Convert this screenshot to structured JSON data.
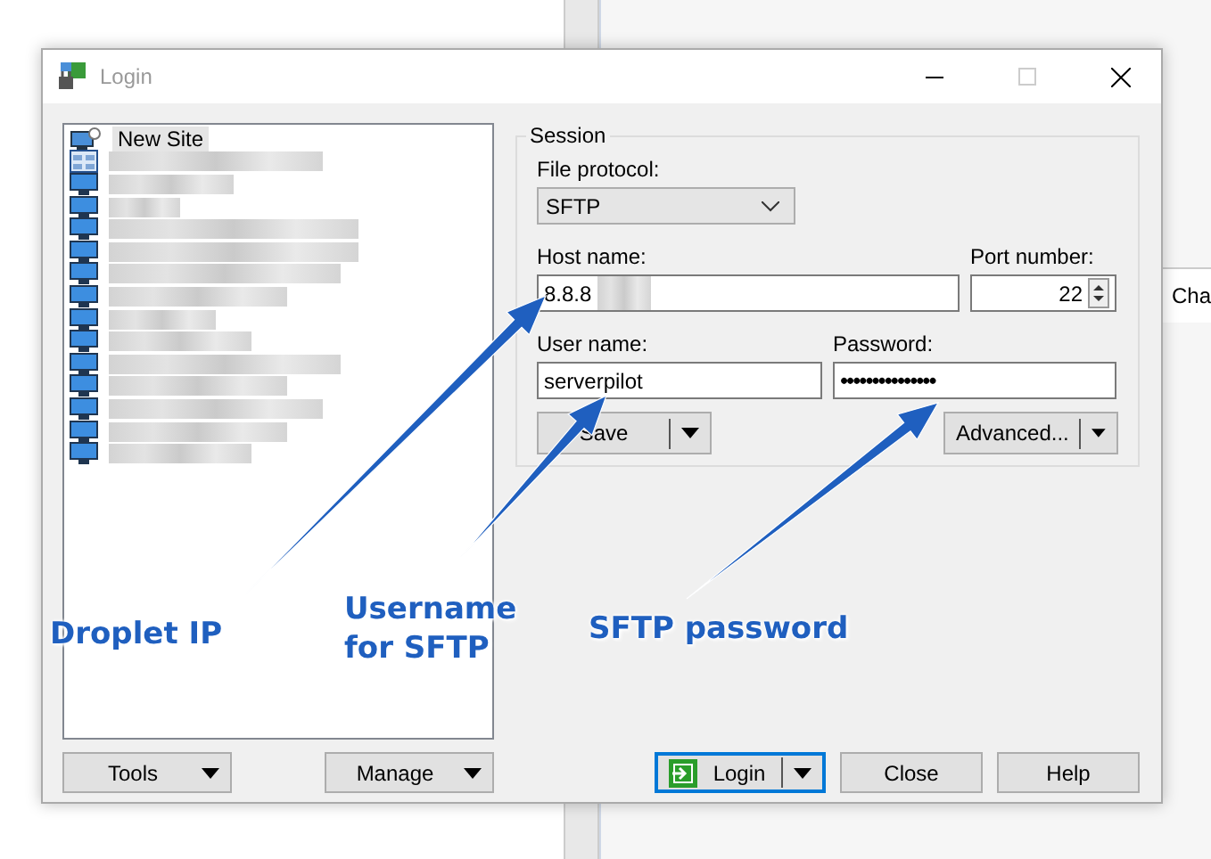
{
  "window": {
    "title": "Login"
  },
  "sites": [
    {
      "kind": "new-site",
      "label": "New Site",
      "selected": true
    },
    {
      "kind": "workspace",
      "selected": false
    },
    {
      "kind": "site",
      "selected": false
    },
    {
      "kind": "site",
      "selected": false
    },
    {
      "kind": "site",
      "selected": false
    },
    {
      "kind": "site",
      "selected": false
    },
    {
      "kind": "site",
      "selected": false
    },
    {
      "kind": "site",
      "selected": false
    },
    {
      "kind": "site",
      "selected": false
    },
    {
      "kind": "site",
      "selected": false
    },
    {
      "kind": "site",
      "selected": false
    },
    {
      "kind": "site",
      "selected": false
    },
    {
      "kind": "site",
      "selected": false
    },
    {
      "kind": "site",
      "selected": false
    },
    {
      "kind": "site",
      "selected": false
    }
  ],
  "session": {
    "title": "Session",
    "protocol": {
      "label": "File protocol:",
      "value": "SFTP"
    },
    "host": {
      "label": "Host name:",
      "value": "8.8.8"
    },
    "port": {
      "label": "Port number:",
      "value": "22"
    },
    "user": {
      "label": "User name:",
      "value": "serverpilot"
    },
    "password": {
      "label": "Password:",
      "value": "•••••••••••••••"
    },
    "save_button": "Save",
    "advanced_button": "Advanced..."
  },
  "left_buttons": [
    "Tools",
    "Manage"
  ],
  "bottom_buttons": [
    {
      "kind": "login",
      "label": "Login",
      "default": true
    },
    {
      "kind": "plain",
      "label": "Close",
      "default": false
    },
    {
      "kind": "plain",
      "label": "Help",
      "default": false
    }
  ],
  "annotations": [
    {
      "text": "Droplet IP"
    },
    {
      "text": "Username\nfor SFTP"
    },
    {
      "text": "SFTP password"
    }
  ],
  "background_window": {
    "tab_label": "Cha"
  }
}
